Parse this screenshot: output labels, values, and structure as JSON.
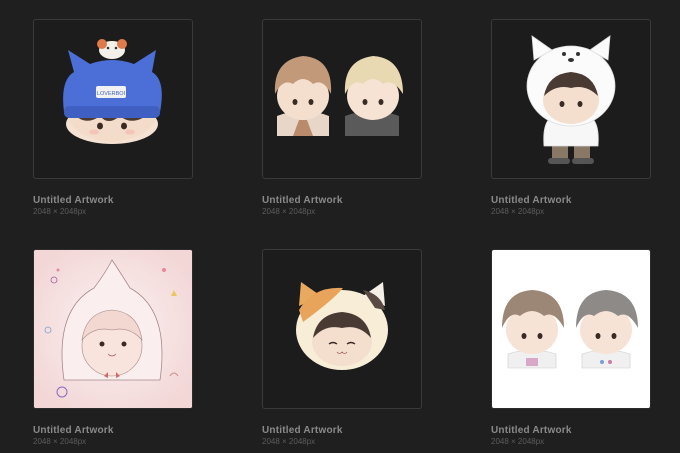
{
  "artworks": [
    {
      "title": "Untitled Artwork",
      "size": "2048 × 2048px",
      "subject": "chibi with blue cat-ear beanie and hamster",
      "background": "dark"
    },
    {
      "title": "Untitled Artwork",
      "size": "2048 × 2048px",
      "subject": "two chibi boys",
      "background": "dark"
    },
    {
      "title": "Untitled Artwork",
      "size": "2048 × 2048px",
      "subject": "chibi in white dog hood",
      "background": "dark"
    },
    {
      "title": "Untitled Artwork",
      "size": "2048 × 2048px",
      "subject": "chibi in peach hood sketch",
      "background": "pink"
    },
    {
      "title": "Untitled Artwork",
      "size": "2048 × 2048px",
      "subject": "chibi in calico cat hood",
      "background": "dark"
    },
    {
      "title": "Untitled Artwork",
      "size": "2048 × 2048px",
      "subject": "two chibi boys sketch",
      "background": "white"
    }
  ],
  "art_texts": {
    "beanie_label": "LOVERBOI"
  },
  "colors": {
    "app_background": "#1f1f1f",
    "thumb_border": "#3a3a3a",
    "title_text": "#8a8a8a",
    "size_text": "#5c5c5c"
  }
}
